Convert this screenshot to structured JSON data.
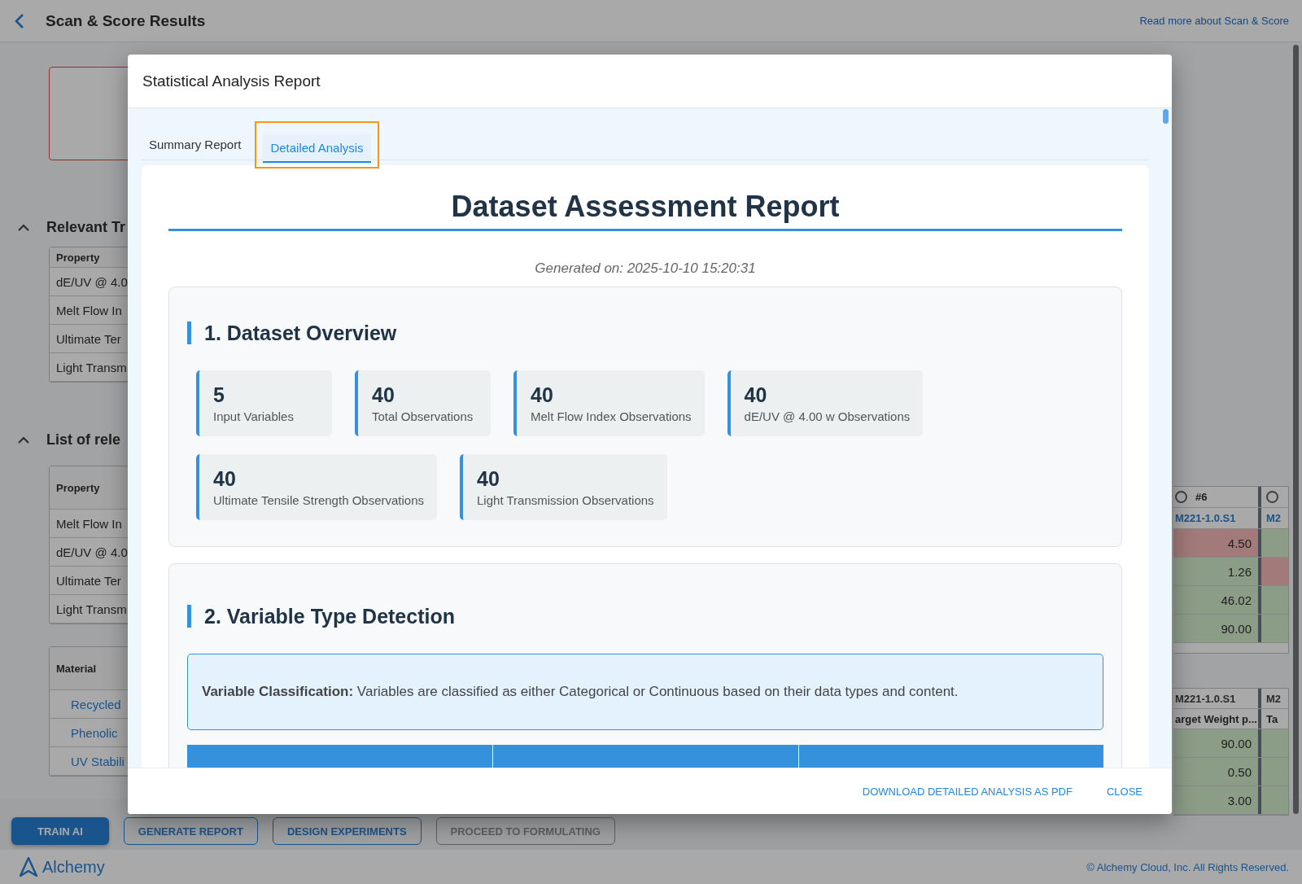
{
  "page": {
    "title": "Scan & Score Results",
    "help_link": "Read more about Scan & Score"
  },
  "left_panel": {
    "sections": [
      {
        "title": "Relevant Tr",
        "expanded": true,
        "tables": [
          {
            "header": "Property",
            "kind": "compact",
            "rows": [
              "dE/UV @ 4.0",
              "Melt Flow In",
              "Ultimate Ter",
              "Light Transm"
            ]
          }
        ]
      },
      {
        "title": "List of rele",
        "expanded": true,
        "tables": [
          {
            "header": "Property",
            "kind": "comparison",
            "rows": [
              "Melt Flow In",
              "dE/UV @ 4.0",
              "Ultimate Ter",
              "Light Transm"
            ]
          },
          {
            "header": "Material",
            "kind": "materials",
            "rows": [
              "Recycled",
              "Phenolic",
              "UV Stabili"
            ]
          }
        ]
      }
    ]
  },
  "right_panel": {
    "property_table": {
      "column_label": "#6",
      "columns_selected": [
        false,
        false
      ],
      "sample_ids": [
        "M221-1.0.S1",
        "M2"
      ],
      "rows": [
        {
          "value": "4.50",
          "out_of_range": true,
          "next_out_of_range": false
        },
        {
          "value": "1.26",
          "out_of_range": false,
          "next_out_of_range": true
        },
        {
          "value": "46.02",
          "out_of_range": false,
          "next_out_of_range": false
        },
        {
          "value": "90.00",
          "out_of_range": false,
          "next_out_of_range": false
        }
      ]
    },
    "material_table": {
      "sample_ids": [
        "M221-1.0.S1",
        "M2"
      ],
      "subheaders": [
        "arget Weight p...",
        "Ta"
      ],
      "rows": [
        {
          "value": "90.00",
          "out_of_range": false,
          "next_out_of_range": false
        },
        {
          "value": "0.50",
          "out_of_range": false,
          "next_out_of_range": false
        },
        {
          "value": "3.00",
          "out_of_range": false,
          "next_out_of_range": false
        }
      ]
    }
  },
  "action_bar": [
    {
      "label": "TRAIN AI",
      "kind": "primary"
    },
    {
      "label": "GENERATE REPORT",
      "kind": "outlined"
    },
    {
      "label": "DESIGN EXPERIMENTS",
      "kind": "outlined"
    },
    {
      "label": "PROCEED TO FORMULATING",
      "kind": "disabled"
    }
  ],
  "footer": {
    "brand": "Alchemy",
    "copyright": "© Alchemy Cloud, Inc. All Rights Reserved."
  },
  "modal": {
    "title": "Statistical Analysis Report",
    "tabs": [
      {
        "label": "Summary Report",
        "selected": false,
        "highlighted": false
      },
      {
        "label": "Detailed Analysis",
        "selected": true,
        "highlighted": true
      }
    ],
    "report": {
      "title": "Dataset Assessment Report",
      "generated": "Generated on: 2025-10-10 15:20:31",
      "overview": {
        "heading": "1. Dataset Overview",
        "stats": [
          {
            "value": "5",
            "label": "Input Variables"
          },
          {
            "value": "40",
            "label": "Total Observations"
          },
          {
            "value": "40",
            "label": "Melt Flow Index Observations"
          },
          {
            "value": "40",
            "label": "dE/UV @ 4.00 w Observations"
          },
          {
            "value": "40",
            "label": "Ultimate Tensile Strength Observations"
          },
          {
            "value": "40",
            "label": "Light Transmission Observations"
          }
        ]
      },
      "detection": {
        "heading": "2. Variable Type Detection",
        "note": "**Variable Classification:** Variables are classified as either Categorical or Continuous based on their data types and content."
      }
    },
    "actions": [
      "DOWNLOAD DETAILED ANALYSIS AS PDF",
      "CLOSE"
    ]
  }
}
